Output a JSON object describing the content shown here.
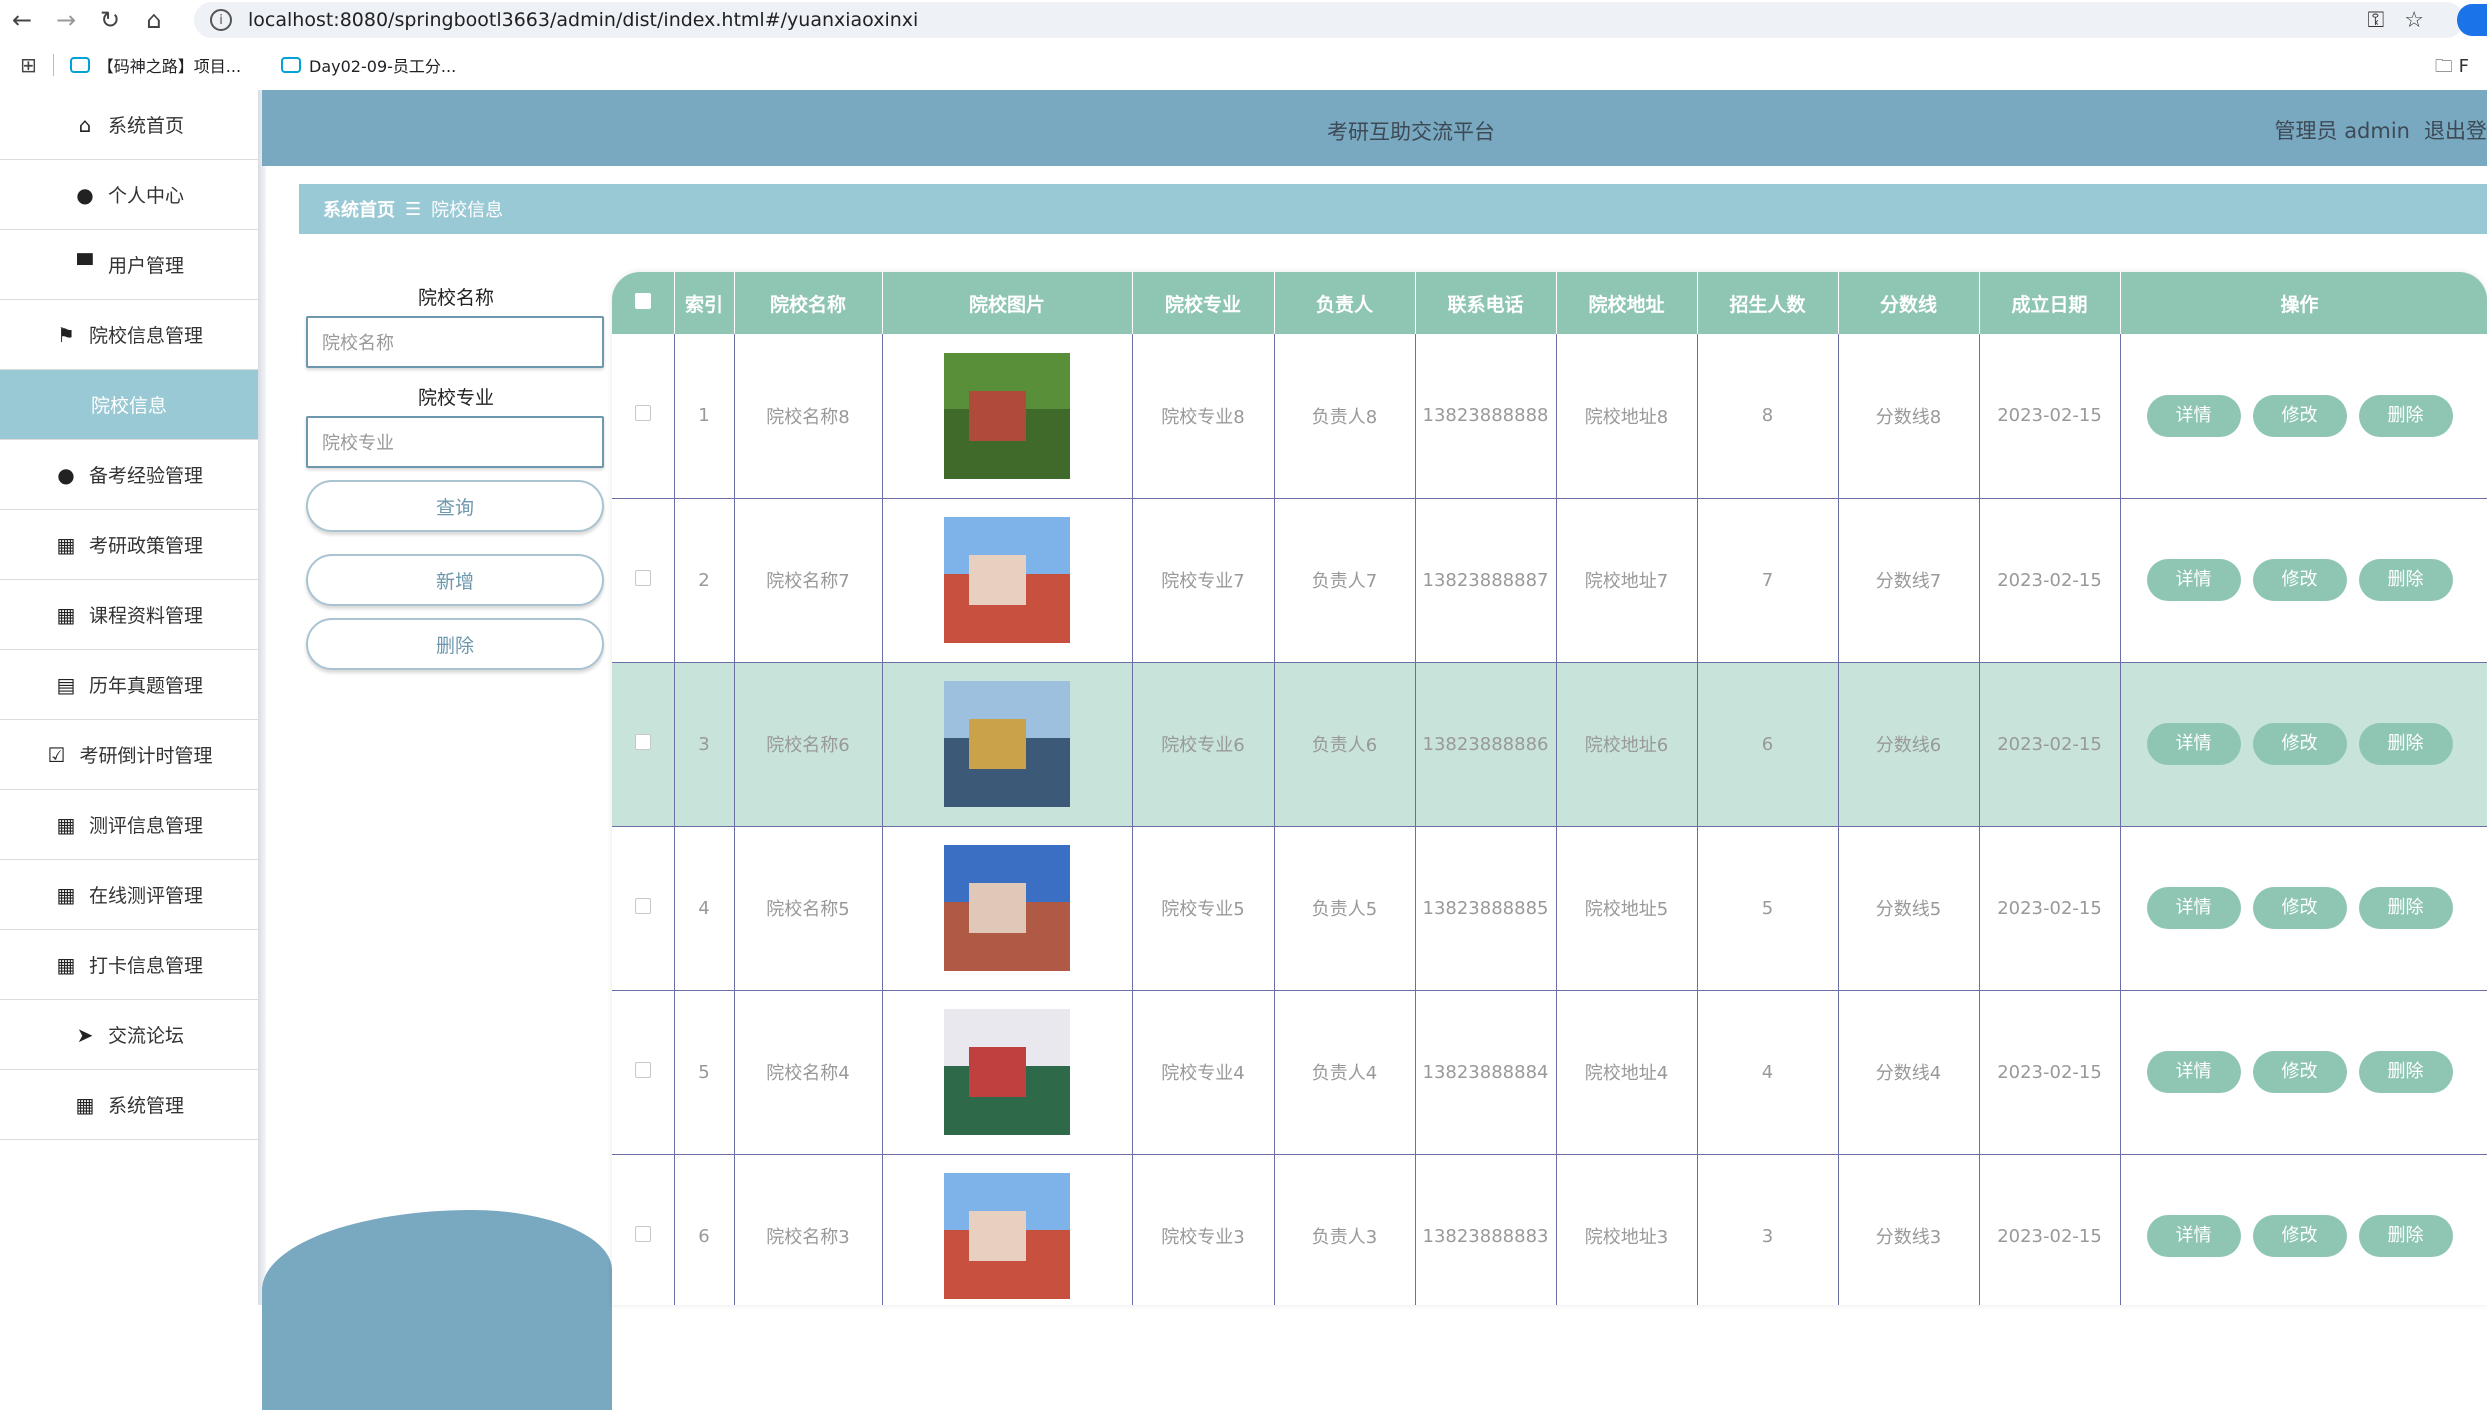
{
  "browser": {
    "url": "localhost:8080/springbootl3663/admin/dist/index.html#/yuanxiaoxinxi",
    "bookmarks": [
      "【码神之路】项目...",
      "Day02-09-员工分..."
    ],
    "folder_label": "F"
  },
  "sidebar": {
    "items": [
      {
        "label": "系统首页",
        "icon": "home-icon"
      },
      {
        "label": "个人中心",
        "icon": "user-icon"
      },
      {
        "label": "用户管理",
        "icon": "monitor-icon"
      },
      {
        "label": "院校信息管理",
        "icon": "flag-icon"
      },
      {
        "label": "院校信息",
        "icon": "",
        "active": true
      },
      {
        "label": "备考经验管理",
        "icon": "user-icon"
      },
      {
        "label": "考研政策管理",
        "icon": "grid-icon"
      },
      {
        "label": "课程资料管理",
        "icon": "grid-icon"
      },
      {
        "label": "历年真题管理",
        "icon": "clipboard-icon"
      },
      {
        "label": "考研倒计时管理",
        "icon": "clipboard-check-icon"
      },
      {
        "label": "测评信息管理",
        "icon": "grid-icon"
      },
      {
        "label": "在线测评管理",
        "icon": "grid-icon"
      },
      {
        "label": "打卡信息管理",
        "icon": "grid-icon"
      },
      {
        "label": "交流论坛",
        "icon": "send-icon"
      },
      {
        "label": "系统管理",
        "icon": "grid-icon"
      }
    ]
  },
  "header": {
    "title": "考研互助交流平台",
    "user": "管理员 admin",
    "logout": "退出登"
  },
  "breadcrumb": {
    "home": "系统首页",
    "separator": "☰",
    "current": "院校信息"
  },
  "search": {
    "name_label": "院校名称",
    "name_placeholder": "院校名称",
    "major_label": "院校专业",
    "major_placeholder": "院校专业",
    "query_btn": "查询",
    "add_btn": "新增",
    "delete_btn": "删除"
  },
  "table": {
    "columns": [
      "索引",
      "院校名称",
      "院校图片",
      "院校专业",
      "负责人",
      "联系电话",
      "院校地址",
      "招生人数",
      "分数线",
      "成立日期",
      "操作"
    ],
    "rows": [
      {
        "index": "1",
        "name": "院校名称8",
        "major": "院校专业8",
        "owner": "负责人8",
        "phone": "13823888888",
        "address": "院校地址8",
        "count": "8",
        "score": "分数线8",
        "date": "2023-02-15",
        "highlight": false
      },
      {
        "index": "2",
        "name": "院校名称7",
        "major": "院校专业7",
        "owner": "负责人7",
        "phone": "13823888887",
        "address": "院校地址7",
        "count": "7",
        "score": "分数线7",
        "date": "2023-02-15",
        "highlight": false
      },
      {
        "index": "3",
        "name": "院校名称6",
        "major": "院校专业6",
        "owner": "负责人6",
        "phone": "13823888886",
        "address": "院校地址6",
        "count": "6",
        "score": "分数线6",
        "date": "2023-02-15",
        "highlight": true
      },
      {
        "index": "4",
        "name": "院校名称5",
        "major": "院校专业5",
        "owner": "负责人5",
        "phone": "13823888885",
        "address": "院校地址5",
        "count": "5",
        "score": "分数线5",
        "date": "2023-02-15",
        "highlight": false
      },
      {
        "index": "5",
        "name": "院校名称4",
        "major": "院校专业4",
        "owner": "负责人4",
        "phone": "13823888884",
        "address": "院校地址4",
        "count": "4",
        "score": "分数线4",
        "date": "2023-02-15",
        "highlight": false
      },
      {
        "index": "6",
        "name": "院校名称3",
        "major": "院校专业3",
        "owner": "负责人3",
        "phone": "13823888883",
        "address": "院校地址3",
        "count": "3",
        "score": "分数线3",
        "date": "2023-02-15",
        "highlight": false
      }
    ],
    "actions": {
      "detail": "详情",
      "edit": "修改",
      "delete": "删除"
    }
  },
  "colors": {
    "header": "#79a8c1",
    "active_menu": "#9ac9d6",
    "table_header": "#8fc6b3",
    "highlight_row": "#c8e3d9"
  }
}
